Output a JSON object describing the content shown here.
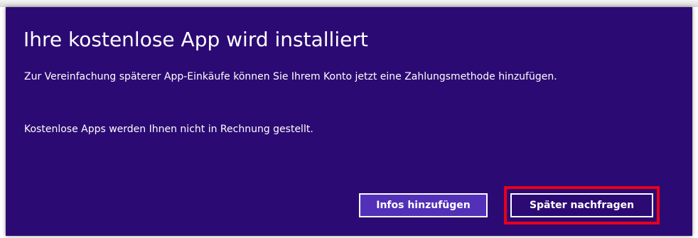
{
  "dialog": {
    "title": "Ihre kostenlose App wird installiert",
    "paragraph1": "Zur Vereinfachung späterer App-Einkäufe können Sie Ihrem Konto jetzt eine Zahlungsmethode hinzufügen.",
    "paragraph2": "Kostenlose Apps werden Ihnen nicht in Rechnung gestellt.",
    "buttons": {
      "add_info": "Infos hinzufügen",
      "ask_later": "Später nachfragen"
    }
  },
  "colors": {
    "dialog_background": "#2c0a73",
    "primary_button": "#5230b7",
    "highlight": "#e8001c",
    "text": "#ffffff"
  }
}
